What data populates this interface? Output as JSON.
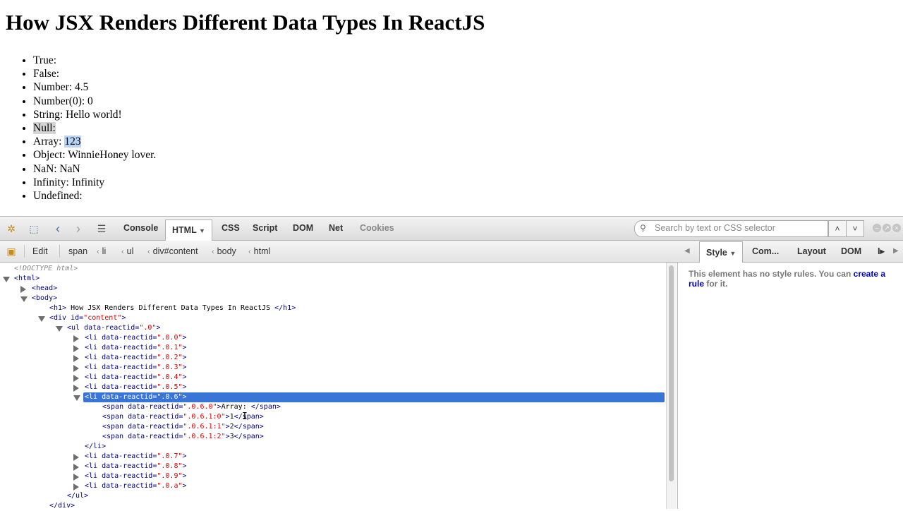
{
  "page": {
    "title": "How JSX Renders Different Data Types In ReactJS",
    "items": [
      {
        "label": "True:",
        "value": ""
      },
      {
        "label": "False:",
        "value": ""
      },
      {
        "label": "Number:",
        "value": "4.5"
      },
      {
        "label": "Number(0):",
        "value": "0"
      },
      {
        "label": "String:",
        "value": "Hello world!"
      },
      {
        "label": "Null:",
        "value": ""
      },
      {
        "label": "Array:",
        "value": "123"
      },
      {
        "label": "Object:",
        "value": "WinnieHoney lover."
      },
      {
        "label": "NaN:",
        "value": "NaN"
      },
      {
        "label": "Infinity:",
        "value": "Infinity"
      },
      {
        "label": "Undefined:",
        "value": ""
      }
    ]
  },
  "firebug": {
    "tabs": [
      "Console",
      "HTML",
      "CSS",
      "Script",
      "DOM",
      "Net",
      "Cookies"
    ],
    "search_placeholder": "Search by text or CSS selector",
    "edit_label": "Edit",
    "breadcrumbs": [
      "span",
      "li",
      "ul",
      "div#content",
      "body",
      "html"
    ],
    "side_tabs": [
      "Style",
      "Com...",
      "Layout",
      "DOM"
    ],
    "side_message": "This element has no style rules. You can",
    "side_link": "create a rule",
    "side_message_end": "for it."
  },
  "tree": {
    "doctype": "<!DOCTYPE html>",
    "html_open": "<html>",
    "head": "<head>",
    "body": "<body>",
    "h1_open": "<h1>",
    "h1_text": "How JSX Renders Different Data Types In ReactJS",
    "h1_close": "</h1>",
    "div_tag": "<div id=",
    "div_val": "\"content\"",
    "ul_tag": "<ul data-reactid=",
    "ul_val": "\".0\"",
    "li_tag": "<li data-reactid=",
    "li_ids": [
      "\".0.0\"",
      "\".0.1\"",
      "\".0.2\"",
      "\".0.3\"",
      "\".0.4\"",
      "\".0.5\"",
      "\".0.6\"",
      "\".0.7\"",
      "\".0.8\"",
      "\".0.9\"",
      "\".0.a\""
    ],
    "span_tag": "<span data-reactid=",
    "span_ids": [
      "\".0.6.0\"",
      "\".0.6.1:0\"",
      "\".0.6.1:1\"",
      "\".0.6.1:2\""
    ],
    "span_texts": [
      "Array: ",
      "1",
      "2",
      "3"
    ],
    "span_close": "</span>",
    "li_close": "</li>",
    "ul_close": "</ul>",
    "div_close": "</div>",
    "gt": ">"
  },
  "colors": {
    "selection": "#3875d7",
    "attr_value": "#dd0000",
    "tag": "#000080"
  }
}
